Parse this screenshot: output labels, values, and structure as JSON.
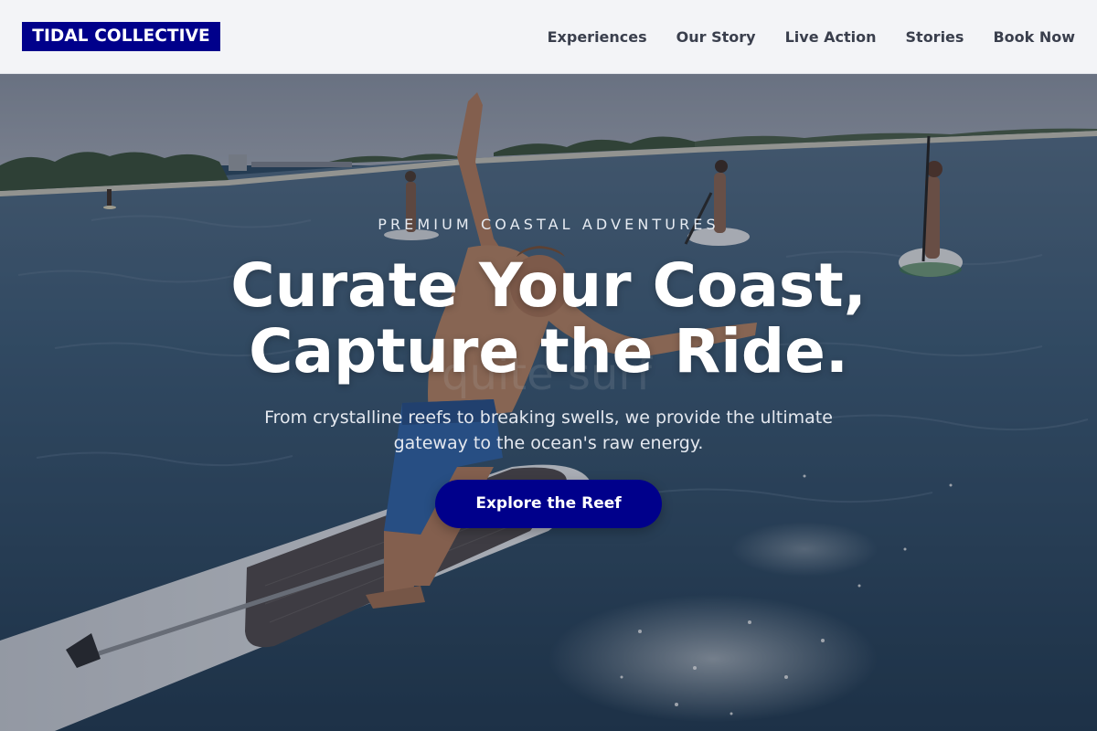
{
  "brand": {
    "logo_text": "TIDAL COLLECTIVE",
    "color": "#00008b"
  },
  "nav": {
    "items": [
      {
        "label": "Experiences"
      },
      {
        "label": "Our Story"
      },
      {
        "label": "Live Action"
      },
      {
        "label": "Stories"
      },
      {
        "label": "Book Now"
      }
    ]
  },
  "hero": {
    "eyebrow": "PREMIUM COASTAL ADVENTURES",
    "headline_line1": "Curate Your Coast,",
    "headline_line2": "Capture the Ride.",
    "subtext_line1": "From crystalline reefs to breaking swells, we provide the ultimate",
    "subtext_line2": "gateway to the ocean's raw energy.",
    "cta_label": "Explore the Reef",
    "cta_color": "#00008b",
    "background_watermark": "quite surf"
  }
}
